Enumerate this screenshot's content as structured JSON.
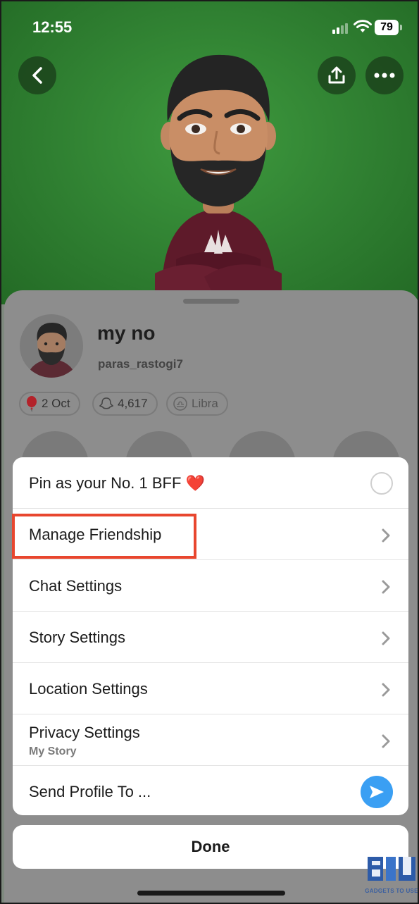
{
  "status_bar": {
    "time": "12:55",
    "battery": "79"
  },
  "profile": {
    "display_name": "my no",
    "username": "paras_rastogi7",
    "chips": {
      "birthday": "2 Oct",
      "snap_score": "4,617",
      "zodiac": "Libra"
    }
  },
  "menu": {
    "items": [
      {
        "label": "Pin as your No. 1 BFF ❤️",
        "control": "radio",
        "sub": ""
      },
      {
        "label": "Manage Friendship",
        "control": "chevron",
        "sub": ""
      },
      {
        "label": "Chat Settings",
        "control": "chevron",
        "sub": ""
      },
      {
        "label": "Story Settings",
        "control": "chevron",
        "sub": ""
      },
      {
        "label": "Location Settings",
        "control": "chevron",
        "sub": ""
      },
      {
        "label": "Privacy Settings",
        "control": "chevron",
        "sub": "My Story"
      },
      {
        "label": "Send Profile To ...",
        "control": "send-icon",
        "sub": ""
      }
    ],
    "highlighted_item": "Manage Friendship",
    "highlight_color": "#e8462e"
  },
  "done_label": "Done",
  "watermark": {
    "text": "GADGETS TO USE"
  },
  "colors": {
    "hero_background": "#2f7f31",
    "send_button": "#3a9ff3",
    "overlay": "#8d8d8d"
  }
}
